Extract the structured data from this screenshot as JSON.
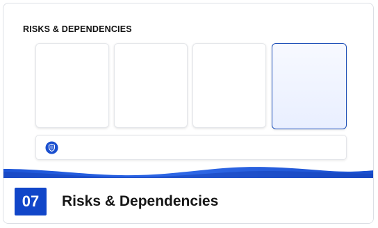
{
  "section": {
    "title": "RISKS & DEPENDENCIES"
  },
  "tiles": [
    {
      "id": "tile-1",
      "state": "default"
    },
    {
      "id": "tile-2",
      "state": "default"
    },
    {
      "id": "tile-3",
      "state": "default"
    },
    {
      "id": "tile-4",
      "state": "selected"
    }
  ],
  "info_bar": {
    "icon": "shield-icon"
  },
  "footer": {
    "number": "07",
    "title": "Risks & Dependencies"
  },
  "colors": {
    "accent": "#1146c9",
    "wave": "#1a56d6",
    "selected_border": "#1d4fb8"
  }
}
